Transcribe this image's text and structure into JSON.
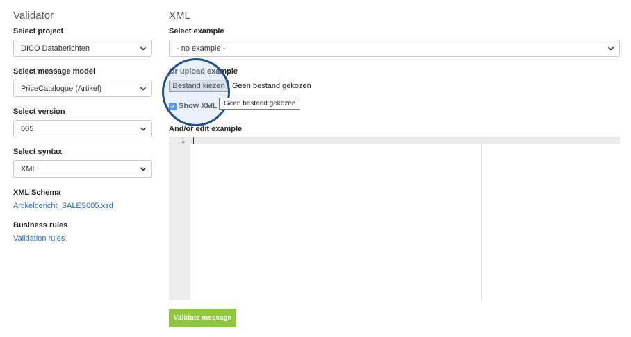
{
  "left": {
    "title": "Validator",
    "project": {
      "label": "Select project",
      "value": "DICO Databerichten"
    },
    "message_model": {
      "label": "Select message model",
      "value": "PriceCatalogue (Artikel)"
    },
    "version": {
      "label": "Select version",
      "value": "005"
    },
    "syntax": {
      "label": "Select syntax",
      "value": "XML"
    },
    "schema": {
      "label": "XML Schema",
      "link": "Artikelbericht_SALES005.xsd"
    },
    "business": {
      "label": "Business rules",
      "link": "Validation rules"
    }
  },
  "right": {
    "title": "XML",
    "example": {
      "label": "Select example",
      "value": "- no example -"
    },
    "upload": {
      "label": "Or upload example",
      "button": "Bestand kiezen",
      "no_file": "Geen bestand gekozen",
      "tooltip": "Geen bestand gekozen"
    },
    "show_editor": {
      "label": "Show XML ed",
      "checked": true
    },
    "edit": {
      "label": "And/or edit example",
      "line_number": "1"
    },
    "validate_button": "Validate message"
  },
  "colors": {
    "link": "#2a6ebb",
    "validate": "#8ec63f",
    "checkbox": "#1a73e8",
    "magnifier": "#1f4e8c"
  },
  "icons": [
    "chevron-down-icon",
    "checkmark-icon"
  ]
}
